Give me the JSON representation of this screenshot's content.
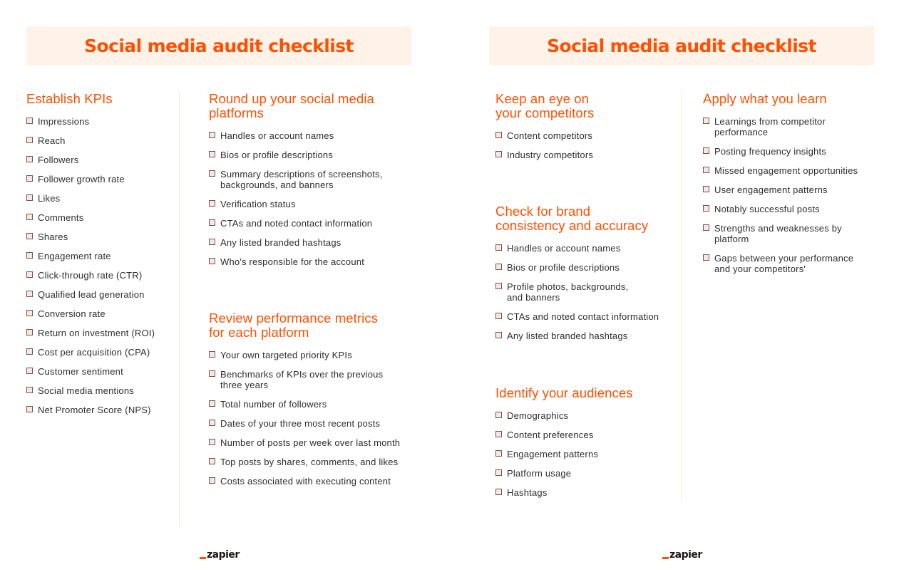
{
  "colors": {
    "accent": "#ff4f00",
    "title_bg": "#fff3e9",
    "divider": "#efecd6"
  },
  "logo": "zapier",
  "pages": [
    {
      "title": "Social media audit checklist",
      "sections": [
        {
          "heading": [
            "Establish KPIs"
          ],
          "items": [
            [
              "Impressions"
            ],
            [
              "Reach"
            ],
            [
              "Followers"
            ],
            [
              "Follower growth rate"
            ],
            [
              "Likes"
            ],
            [
              "Comments"
            ],
            [
              "Shares"
            ],
            [
              "Engagement rate"
            ],
            [
              "Click-through rate (CTR)"
            ],
            [
              "Qualified lead generation"
            ],
            [
              "Conversion rate"
            ],
            [
              "Return on investment (ROI)"
            ],
            [
              "Cost per acquisition (CPA)"
            ],
            [
              "Customer sentiment"
            ],
            [
              "Social media mentions"
            ],
            [
              "Net Promoter Score (NPS)"
            ]
          ]
        },
        {
          "heading": [
            "Round up your social media",
            "platforms"
          ],
          "items": [
            [
              "Handles or account names"
            ],
            [
              "Bios or profile descriptions"
            ],
            [
              "Summary descriptions of screenshots,",
              "backgrounds, and banners"
            ],
            [
              "Verification status"
            ],
            [
              "CTAs and noted contact information"
            ],
            [
              "Any listed branded hashtags"
            ],
            [
              "Who's responsible for the account"
            ]
          ]
        },
        {
          "heading": [
            "Review performance metrics",
            "for each platform"
          ],
          "items": [
            [
              "Your own targeted priority KPIs"
            ],
            [
              "Benchmarks of KPIs over the previous",
              "three years"
            ],
            [
              "Total number of followers"
            ],
            [
              "Dates of your three most recent posts"
            ],
            [
              "Number of posts per week over last month"
            ],
            [
              "Top posts by shares, comments, and likes"
            ],
            [
              "Costs associated with executing content"
            ]
          ]
        }
      ]
    },
    {
      "title": "Social media audit checklist",
      "sections": [
        {
          "heading": [
            "Keep an eye on",
            "your competitors"
          ],
          "items": [
            [
              "Content competitors"
            ],
            [
              "Industry competitors"
            ]
          ]
        },
        {
          "heading": [
            "Check for brand",
            "consistency and accuracy"
          ],
          "items": [
            [
              "Handles or account names"
            ],
            [
              "Bios or profile descriptions"
            ],
            [
              "Profile photos, backgrounds,",
              "and banners"
            ],
            [
              "CTAs and noted contact information"
            ],
            [
              "Any listed branded hashtags"
            ]
          ]
        },
        {
          "heading": [
            "Identify your audiences"
          ],
          "items": [
            [
              "Demographics"
            ],
            [
              "Content preferences"
            ],
            [
              "Engagement patterns"
            ],
            [
              "Platform usage"
            ],
            [
              "Hashtags"
            ]
          ]
        },
        {
          "heading": [
            "Apply what you learn"
          ],
          "items": [
            [
              "Learnings from competitor",
              "performance"
            ],
            [
              "Posting frequency insights"
            ],
            [
              "Missed engagement opportunities"
            ],
            [
              "User engagement patterns"
            ],
            [
              "Notably successful posts"
            ],
            [
              "Strengths and weaknesses by",
              "platform"
            ],
            [
              "Gaps between your performance",
              "and your competitors'"
            ]
          ]
        }
      ]
    }
  ]
}
